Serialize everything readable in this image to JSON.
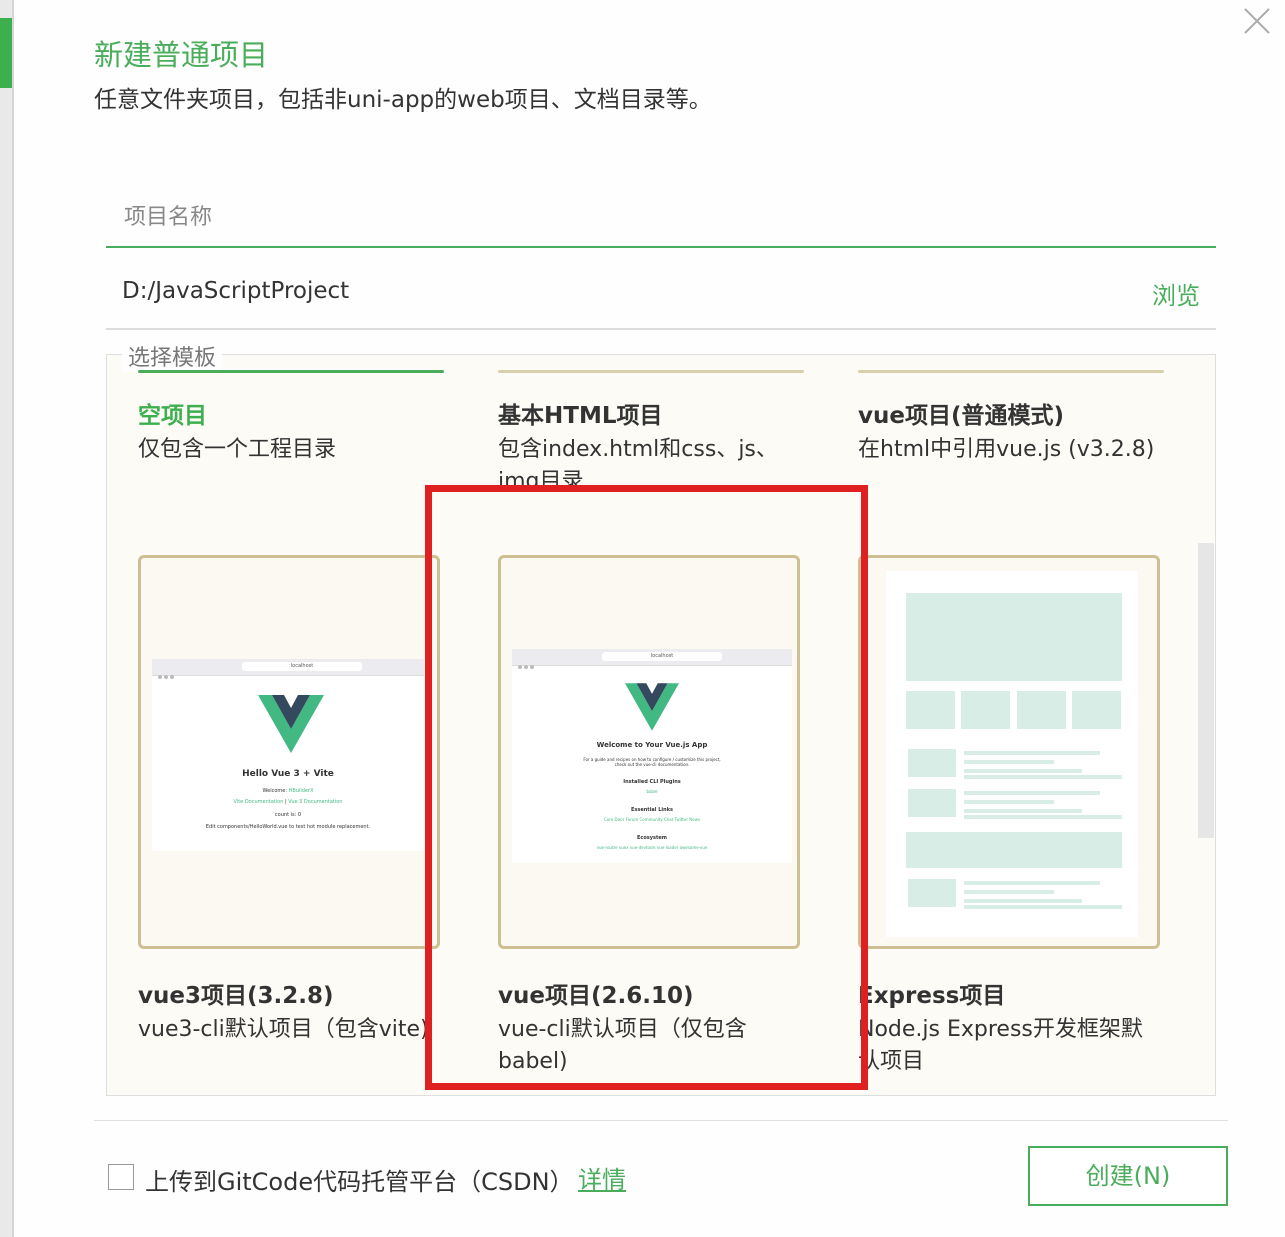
{
  "dialog": {
    "title": "新建普通项目",
    "subtitle": "任意文件夹项目，包括非uni-app的web项目、文档目录等。"
  },
  "project_name": {
    "placeholder": "项目名称",
    "value": ""
  },
  "location": {
    "path": "D:/JavaScriptProject",
    "browse_label": "浏览"
  },
  "templates": {
    "legend": "选择模板",
    "selected": "空项目",
    "items": [
      {
        "title": "空项目",
        "desc": "仅包含一个工程目录"
      },
      {
        "title": "基本HTML项目",
        "desc": "包含index.html和css、js、img目录"
      },
      {
        "title": "vue项目(普通模式)",
        "desc": "在html中引用vue.js (v3.2.8)"
      },
      {
        "title": "vue3项目(3.2.8)",
        "desc": "vue3-cli默认项目（包含vite)"
      },
      {
        "title": "vue项目(2.6.10)",
        "desc": "vue-cli默认项目（仅包含babel)"
      },
      {
        "title": "Express项目",
        "desc": "Node.js Express开发框架默认项目"
      }
    ]
  },
  "previews": {
    "vue3": {
      "url": "localhost",
      "heading": "Hello Vue 3 + Vite",
      "welcome": "Welcome: ",
      "welcome_link": "HBuilderX",
      "docs_link1": "Vite Documentation",
      "docs_sep": " | ",
      "docs_link2": "Vue 3 Documentation",
      "count": "count is: 0",
      "hint": "Edit components/HelloWorld.vue to test hot module replacement."
    },
    "vue2": {
      "url": "localhost",
      "heading": "Welcome to Your Vue.js App",
      "intro": "For a guide and recipes on how to configure / customize this project, check out the vue-cli documentation.",
      "plugins_heading": "Installed CLI Plugins",
      "plugins": "babel",
      "links_heading": "Essential Links",
      "links": "Core Docs   Forum   Community Chat   Twitter   News",
      "eco_heading": "Ecosystem",
      "eco": "vue-router   vuex   vue-devtools   vue-loader   awesome-vue"
    }
  },
  "footer": {
    "upload_checked": false,
    "upload_label": "上传到GitCode代码托管平台（CSDN）",
    "details_link": "详情",
    "create_button": "创建(N)"
  },
  "colors": {
    "accent": "#4aad5b",
    "highlight_box": "#e02020",
    "vue_green": "#42b883",
    "vue_dark": "#35495e"
  }
}
